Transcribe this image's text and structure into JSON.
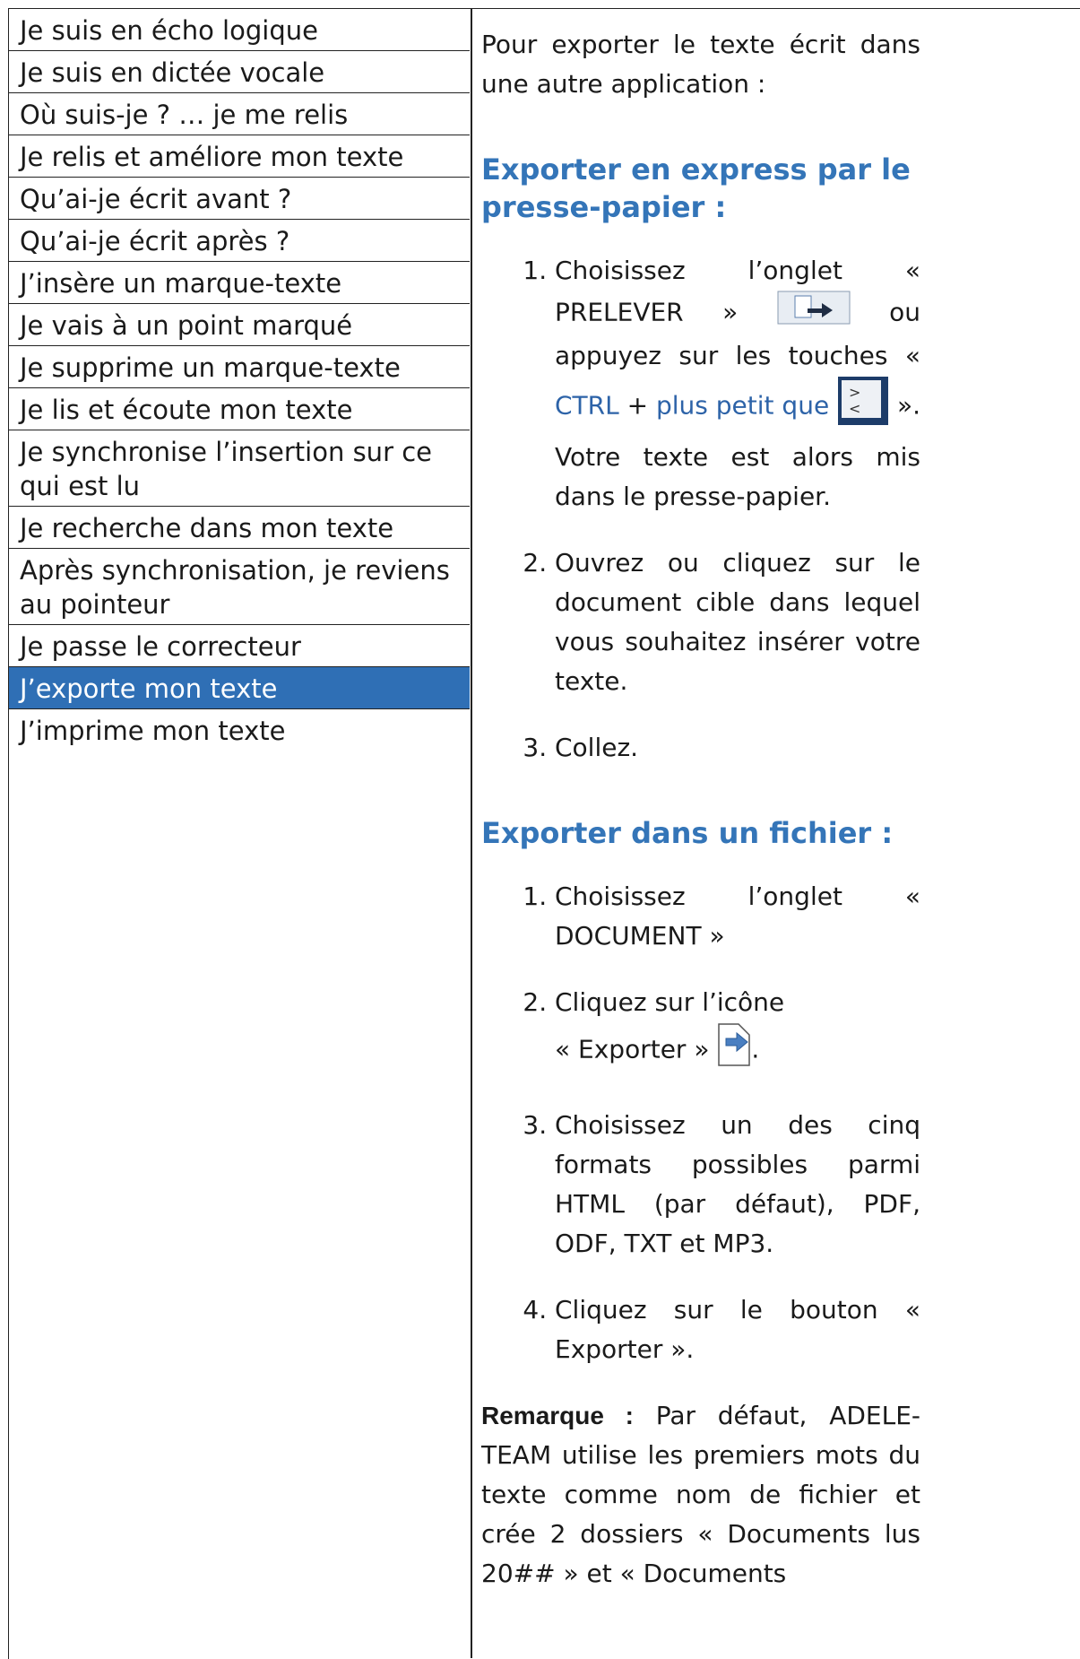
{
  "menu": [
    "Je suis en écho logique",
    "Je suis en dictée vocale",
    "Où suis-je ? … je me relis",
    "Je relis et améliore mon texte",
    "Qu’ai-je écrit avant ?",
    "Qu’ai-je écrit après ?",
    "J’insère un marque-texte",
    "Je vais à un point marqué",
    "Je supprime un marque-texte",
    "Je lis et écoute mon texte",
    "Je synchronise l’insertion sur ce qui est lu",
    "Je recherche dans mon texte",
    "Après synchronisation, je reviens au pointeur",
    "Je passe le correcteur",
    "J’exporte mon texte",
    "J’imprime mon texte"
  ],
  "active_index": 14,
  "content": {
    "intro": "Pour exporter le texte écrit dans une autre application :",
    "section1": {
      "title": "Exporter en express par le presse-papier :",
      "step1_a": "Choisissez l’onglet « PRELEVER »",
      "step1_b": "ou appuyez sur les touches «",
      "step1_ctrl": "CTRL",
      "step1_plus": "+",
      "step1_ptq": "plus petit que",
      "step1_c": "». Votre texte est alors mis dans le presse-papier.",
      "step2": "Ouvrez ou cliquez sur le document cible dans lequel vous souhaitez insérer votre texte.",
      "step3": "Collez."
    },
    "section2": {
      "title": "Exporter dans un fichier :",
      "step1": "Choisissez l’onglet « DOCUMENT »",
      "step2_a": "Cliquez sur l’icône",
      "step2_b": "« Exporter »",
      "step3": "Choisissez un des cinq formats possibles parmi HTML (par défaut), PDF, ODF, TXT et MP3.",
      "step4": "Cliquez sur le bouton « Exporter »."
    },
    "remark_label": "Remarque :",
    "remark_text": "Par défaut, ADELE-TEAM utilise les premiers mots du texte comme nom de fichier et crée 2 dossiers « Documents lus 20## » et « Documents"
  }
}
